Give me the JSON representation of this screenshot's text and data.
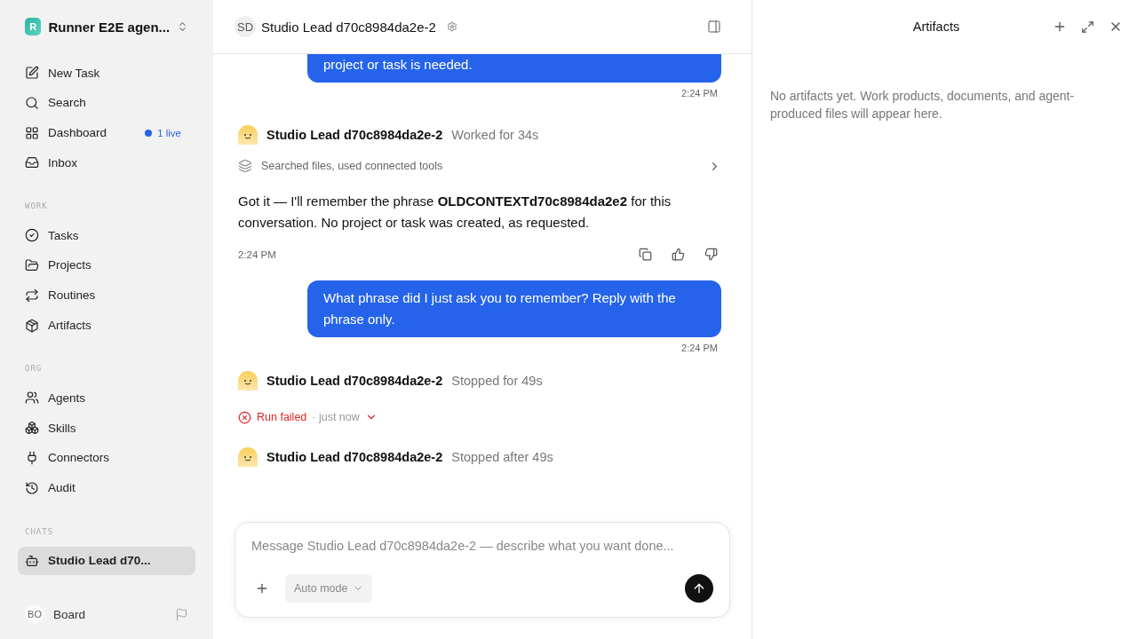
{
  "workspace": {
    "logo": "R",
    "name": "Runner E2E agen..."
  },
  "nav": [
    {
      "label": "New Task",
      "selected": false
    },
    {
      "label": "Search",
      "selected": false
    },
    {
      "label": "Dashboard",
      "selected": false,
      "badge": "1 live"
    },
    {
      "label": "Inbox",
      "selected": false
    }
  ],
  "sections": [
    {
      "title": "WORK",
      "items": [
        {
          "label": "Tasks",
          "selected": false
        },
        {
          "label": "Projects",
          "selected": false
        },
        {
          "label": "Routines",
          "selected": false
        },
        {
          "label": "Artifacts",
          "selected": false
        }
      ]
    },
    {
      "title": "ORG",
      "items": [
        {
          "label": "Agents",
          "selected": false
        },
        {
          "label": "Skills",
          "selected": false
        },
        {
          "label": "Connectors",
          "selected": false
        },
        {
          "label": "Audit",
          "selected": false
        }
      ]
    },
    {
      "title": "CHATS",
      "items": [
        {
          "label": "Studio Lead d70...",
          "selected": true
        }
      ]
    }
  ],
  "user": {
    "initials": "BO",
    "name": "Board"
  },
  "chat_header": {
    "initials": "SD",
    "title": "Studio Lead d70c8984da2e-2"
  },
  "messages": [
    {
      "kind": "user",
      "text": "project or task is needed.",
      "time": "2:24 PM"
    },
    {
      "kind": "agent",
      "name": "Studio Lead d70c8984da2e-2",
      "status": "Worked for 34s",
      "activity": "Searched files, used connected tools",
      "text": "Got it — I'll remember the phrase **OLDCONTEXTd70c8984da2e2** for this conversation. No project or task was created, as requested.",
      "time": "2:24 PM"
    },
    {
      "kind": "user",
      "text": "What phrase did I just ask you to remember? Reply with the phrase only.",
      "time": "2:24 PM"
    },
    {
      "kind": "agent",
      "name": "Studio Lead d70c8984da2e-2",
      "status": "Stopped for 49s",
      "error": "Run failed",
      "error_time": "· just now"
    },
    {
      "kind": "agent",
      "name": "Studio Lead d70c8984da2e-2",
      "status": "Stopped after 49s"
    }
  ],
  "composer": {
    "placeholder": "Message Studio Lead d70c8984da2e-2 — describe what you want done...",
    "mode": "Auto mode"
  },
  "artifacts": {
    "title": "Artifacts",
    "empty_text": "No artifacts yet. Work products, documents, and agent-produced files will appear here."
  }
}
